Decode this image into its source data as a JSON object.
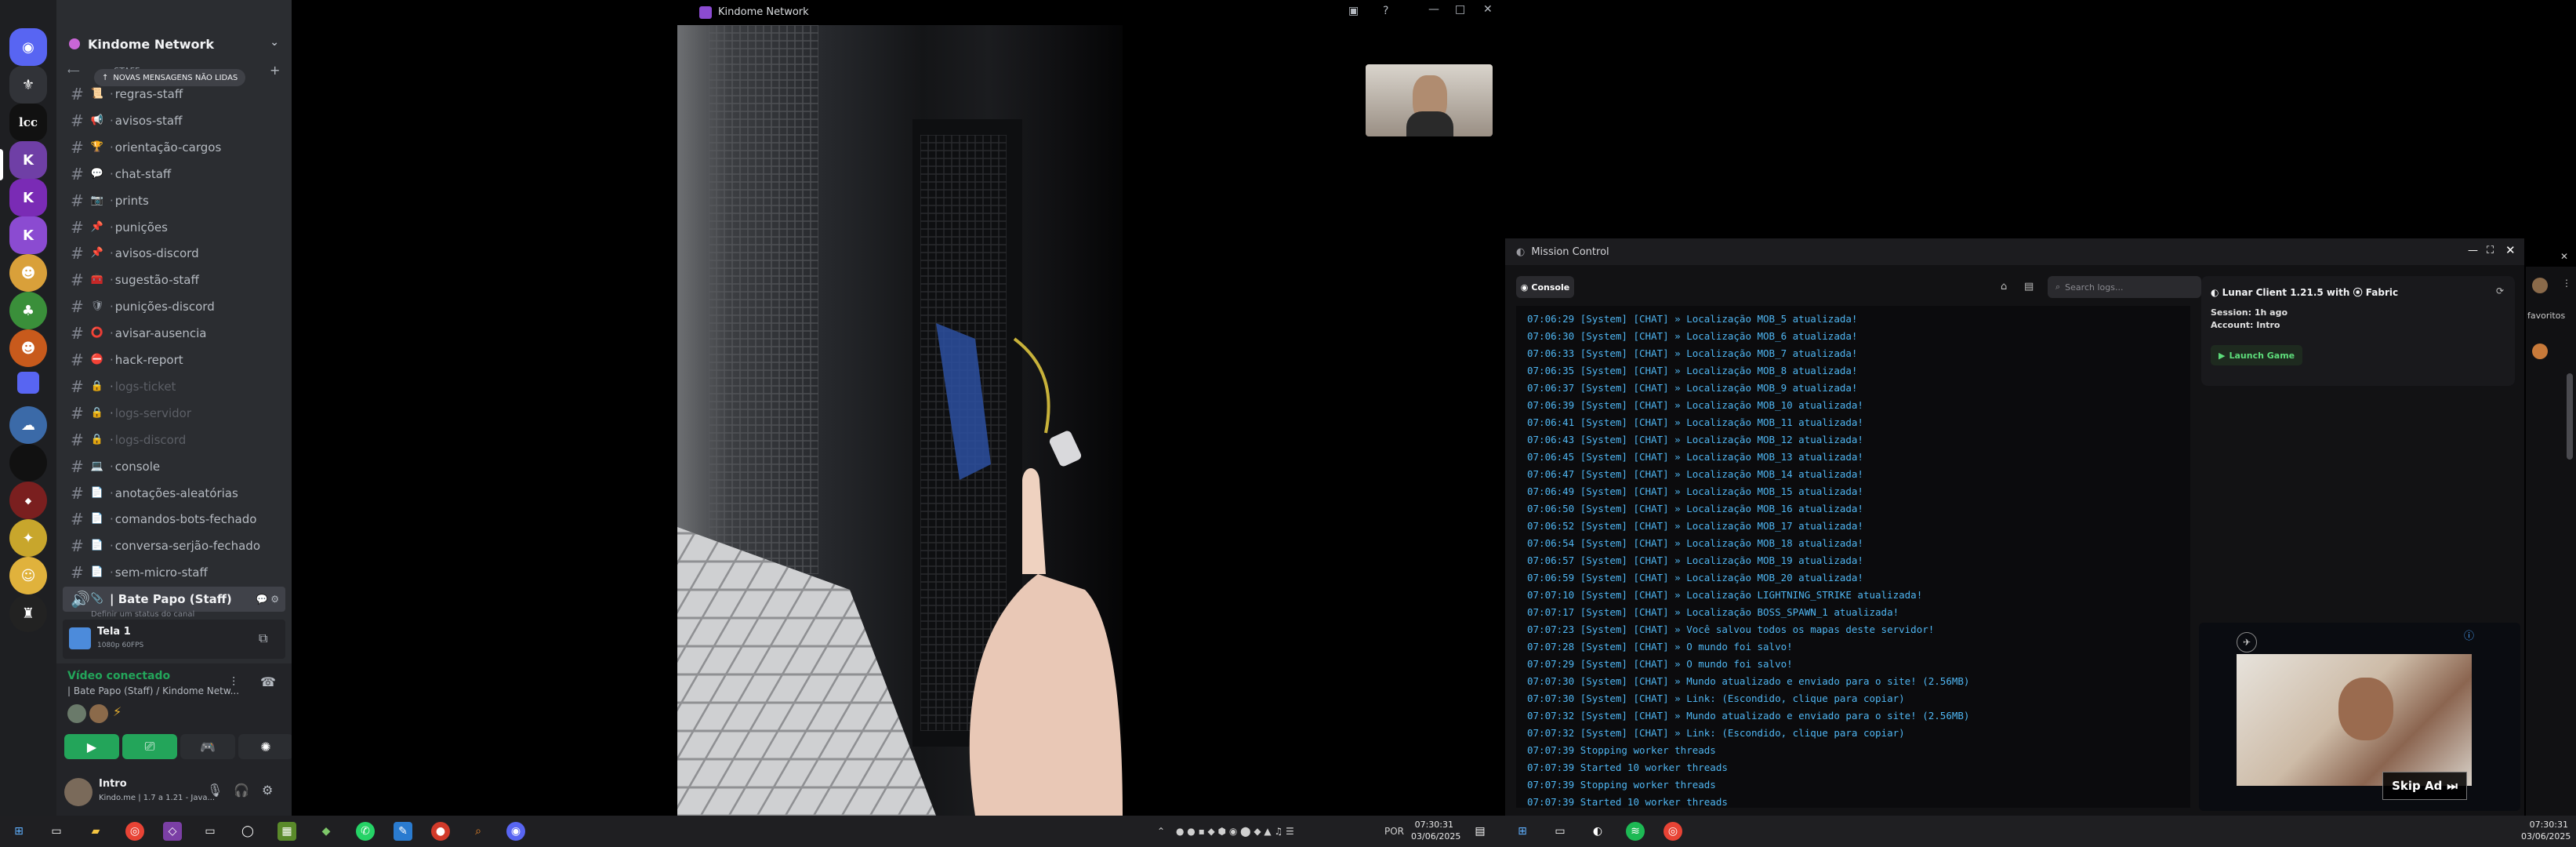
{
  "discord": {
    "server_name": "Kindome Network",
    "new_messages": "NOVAS MENSAGENS NÃO LIDAS",
    "category_peek": "STAFF",
    "channels": [
      {
        "name": "regras-staff",
        "emoji": "📜",
        "muted": false
      },
      {
        "name": "avisos-staff",
        "emoji": "📢",
        "muted": false
      },
      {
        "name": "orientação-cargos",
        "emoji": "🏆",
        "muted": false
      },
      {
        "name": "chat-staff",
        "emoji": "💬",
        "muted": false
      },
      {
        "name": "prints",
        "emoji": "📷",
        "muted": false
      },
      {
        "name": "punições",
        "emoji": "📌",
        "muted": false
      },
      {
        "name": "avisos-discord",
        "emoji": "📌",
        "muted": false
      },
      {
        "name": "sugestão-staff",
        "emoji": "🧰",
        "muted": false
      },
      {
        "name": "punições-discord",
        "emoji": "🛡",
        "muted": false
      },
      {
        "name": "avisar-ausencia",
        "emoji": "⭕",
        "muted": false
      },
      {
        "name": "hack-report",
        "emoji": "⛔",
        "muted": false
      },
      {
        "name": "logs-ticket",
        "emoji": "🔒",
        "muted": true
      },
      {
        "name": "logs-servidor",
        "emoji": "🔒",
        "muted": true
      },
      {
        "name": "logs-discord",
        "emoji": "🔒",
        "muted": true
      },
      {
        "name": "console",
        "emoji": "💻",
        "muted": false
      },
      {
        "name": "anotações-aleatórias",
        "emoji": "📄",
        "muted": false
      },
      {
        "name": "comandos-bots-fechado",
        "emoji": "📄",
        "muted": false
      },
      {
        "name": "conversa-serjão-fechado",
        "emoji": "📄",
        "muted": false
      },
      {
        "name": "sem-micro-staff",
        "emoji": "📄",
        "muted": false
      }
    ],
    "active_voice_channel": "| Bate Papo (Staff)",
    "voice_channel_sub": "Definir um status do canal",
    "stream_preview": {
      "title": "Tela 1",
      "quality": "1080p 60FPS"
    },
    "voice_status": "Vídeo conectado",
    "voice_location": "| Bate Papo (Staff) / Kindome Netw...",
    "user": {
      "name": "Intro",
      "status": "Kindo.me | 1.7 a 1.21 - Java..."
    }
  },
  "window_title": "Kindome Network",
  "mission_control": {
    "title": "Mission Control",
    "tab": "Console",
    "search_placeholder": "Search logs...",
    "client": "Lunar Client 1.21.5 with",
    "loader": "Fabric",
    "session": "Session: 1h ago",
    "account": "Account: Intro",
    "launch": "Launch Game",
    "ad_skip": "Skip Ad",
    "side_label": "favoritos",
    "logs": [
      "07:06:29 [System] [CHAT] » Localização MOB_5 atualizada!",
      "07:06:30 [System] [CHAT] » Localização MOB_6 atualizada!",
      "07:06:33 [System] [CHAT] » Localização MOB_7 atualizada!",
      "07:06:35 [System] [CHAT] » Localização MOB_8 atualizada!",
      "07:06:37 [System] [CHAT] » Localização MOB_9 atualizada!",
      "07:06:39 [System] [CHAT] » Localização MOB_10 atualizada!",
      "07:06:41 [System] [CHAT] » Localização MOB_11 atualizada!",
      "07:06:43 [System] [CHAT] » Localização MOB_12 atualizada!",
      "07:06:45 [System] [CHAT] » Localização MOB_13 atualizada!",
      "07:06:47 [System] [CHAT] » Localização MOB_14 atualizada!",
      "07:06:49 [System] [CHAT] » Localização MOB_15 atualizada!",
      "07:06:50 [System] [CHAT] » Localização MOB_16 atualizada!",
      "07:06:52 [System] [CHAT] » Localização MOB_17 atualizada!",
      "07:06:54 [System] [CHAT] » Localização MOB_18 atualizada!",
      "07:06:57 [System] [CHAT] » Localização MOB_19 atualizada!",
      "07:06:59 [System] [CHAT] » Localização MOB_20 atualizada!",
      "07:07:10 [System] [CHAT] » Localização LIGHTNING_STRIKE atualizada!",
      "07:07:17 [System] [CHAT] » Localização BOSS_SPAWN_1 atualizada!",
      "07:07:23 [System] [CHAT] » Você salvou todos os mapas deste servidor!",
      "07:07:28 [System] [CHAT] » O mundo foi salvo!",
      "07:07:29 [System] [CHAT] » O mundo foi salvo!",
      "07:07:30 [System] [CHAT] » Mundo atualizado e enviado para o site! (2.56MB)",
      "07:07:30 [System] [CHAT] » Link: (Escondido, clique para copiar)",
      "07:07:32 [System] [CHAT] » Mundo atualizado e enviado para o site! (2.56MB)",
      "07:07:32 [System] [CHAT] » Link: (Escondido, clique para copiar)",
      "07:07:39 Stopping worker threads",
      "07:07:39 Started 10 worker threads",
      "07:07:39 Stopping worker threads",
      "07:07:39 Started 10 worker threads"
    ]
  },
  "taskbar": {
    "lang": "POR",
    "time1": "07:30:31",
    "date1": "03/06/2025",
    "time2": "07:30:31",
    "date2": "03/06/2025"
  },
  "colors": {
    "discord_bg": "#2b2d31",
    "rail_bg": "#1e1f22",
    "log_text": "#4fb6f2",
    "accent": "#23a55a"
  }
}
